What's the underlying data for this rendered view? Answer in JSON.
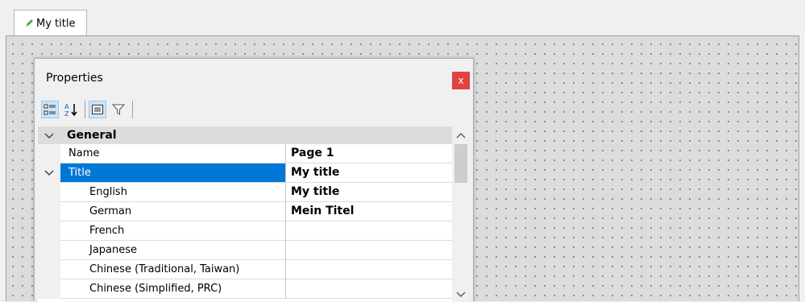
{
  "tab": {
    "label": "My title",
    "icon": "pencil-icon"
  },
  "properties": {
    "title": "Properties",
    "close_label": "x",
    "close_color": "#e04343",
    "toolbar": [
      {
        "icon": "categorized-icon",
        "active": true
      },
      {
        "icon": "sort-alphabetical-icon",
        "active": false
      },
      {
        "icon": "property-pages-icon",
        "active": true
      },
      {
        "icon": "filter-icon",
        "active": false
      }
    ],
    "category": "General",
    "rows": [
      {
        "name": "Name",
        "value": "Page 1"
      },
      {
        "name": "Title",
        "value": "My title"
      },
      {
        "name": "English",
        "value": "My title"
      },
      {
        "name": "German",
        "value": "Mein Titel"
      },
      {
        "name": "French",
        "value": ""
      },
      {
        "name": "Japanese",
        "value": ""
      },
      {
        "name": "Chinese (Traditional, Taiwan)",
        "value": ""
      },
      {
        "name": "Chinese (Simplified, PRC)",
        "value": ""
      }
    ],
    "selection_color": "#0078d7"
  }
}
